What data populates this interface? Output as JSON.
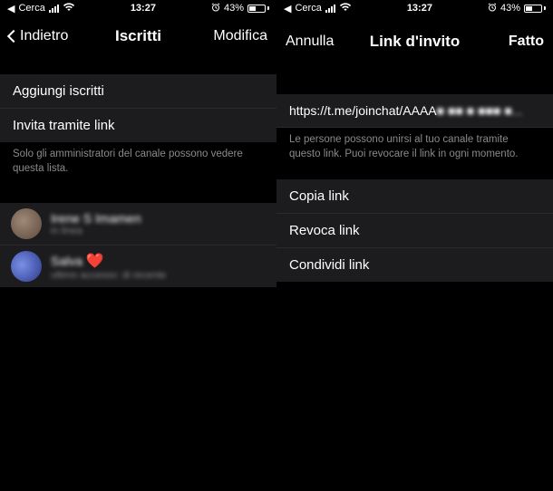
{
  "status": {
    "back_app": "Cerca",
    "time": "13:27",
    "battery_pct": "43%"
  },
  "left": {
    "nav_back": "Indietro",
    "nav_title": "Iscritti",
    "nav_edit": "Modifica",
    "rows": {
      "add": "Aggiungi iscritti",
      "invite": "Invita tramite link"
    },
    "footer": "Solo gli amministratori del canale possono vedere questa lista.",
    "members": [
      {
        "name": "Irene S Imamen",
        "sub": "in linea",
        "avatar_bg": "#6b5b52"
      },
      {
        "name": "Salva ",
        "sub": "ultimo accesso: di recente",
        "avatar_bg": "#4a6bd6"
      }
    ]
  },
  "right": {
    "nav_cancel": "Annulla",
    "nav_title": "Link d'invito",
    "nav_done": "Fatto",
    "link_prefix": "https://t.me/joinchat/AAAA",
    "link_obscured": "■ ■■  ■  ■■■  ■...",
    "note": "Le persone possono unirsi al tuo canale tramite questo link. Puoi revocare il link in ogni momento.",
    "actions": {
      "copy": "Copia link",
      "revoke": "Revoca link",
      "share": "Condividi link"
    }
  }
}
